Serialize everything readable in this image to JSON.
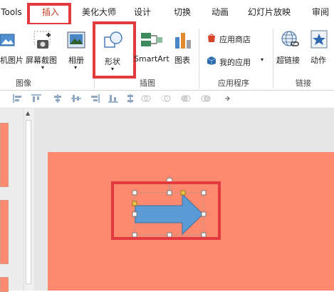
{
  "tabs": [
    "Tools",
    "插入",
    "美化大师",
    "设计",
    "切换",
    "动画",
    "幻灯片放映",
    "审阅"
  ],
  "active_tab": "插入",
  "ribbon": {
    "buttons": {
      "picture": "机图片",
      "screenshot": "屏幕截图",
      "album": "相册",
      "shapes": "形状",
      "smartart": "SmartArt",
      "chart": "图表",
      "app_store": "应用商店",
      "my_apps": "我的应用",
      "hyperlink": "超链接",
      "action": "动作"
    },
    "groups": {
      "images": "图像",
      "illustrations": "插图",
      "apps": "应用程序",
      "links": "链接"
    }
  },
  "colors": {
    "slide_background": "#fd8a6e",
    "arrow_fill": "#5b9bd5",
    "highlight": "#e23a3e",
    "store_icon": "#d9452b",
    "apps_icon": "#2b6cb0"
  },
  "icons": {
    "picture": "online-picture-icon",
    "screenshot": "camera-icon",
    "album": "photo-album-icon",
    "shapes": "shapes-icon",
    "smartart": "smartart-icon",
    "chart": "bar-chart-icon",
    "store": "store-bag-icon",
    "my_apps": "cube-icon",
    "hyperlink": "globe-link-icon",
    "action": "star-icon"
  },
  "canvas": {
    "selected_shape": "right-arrow"
  }
}
